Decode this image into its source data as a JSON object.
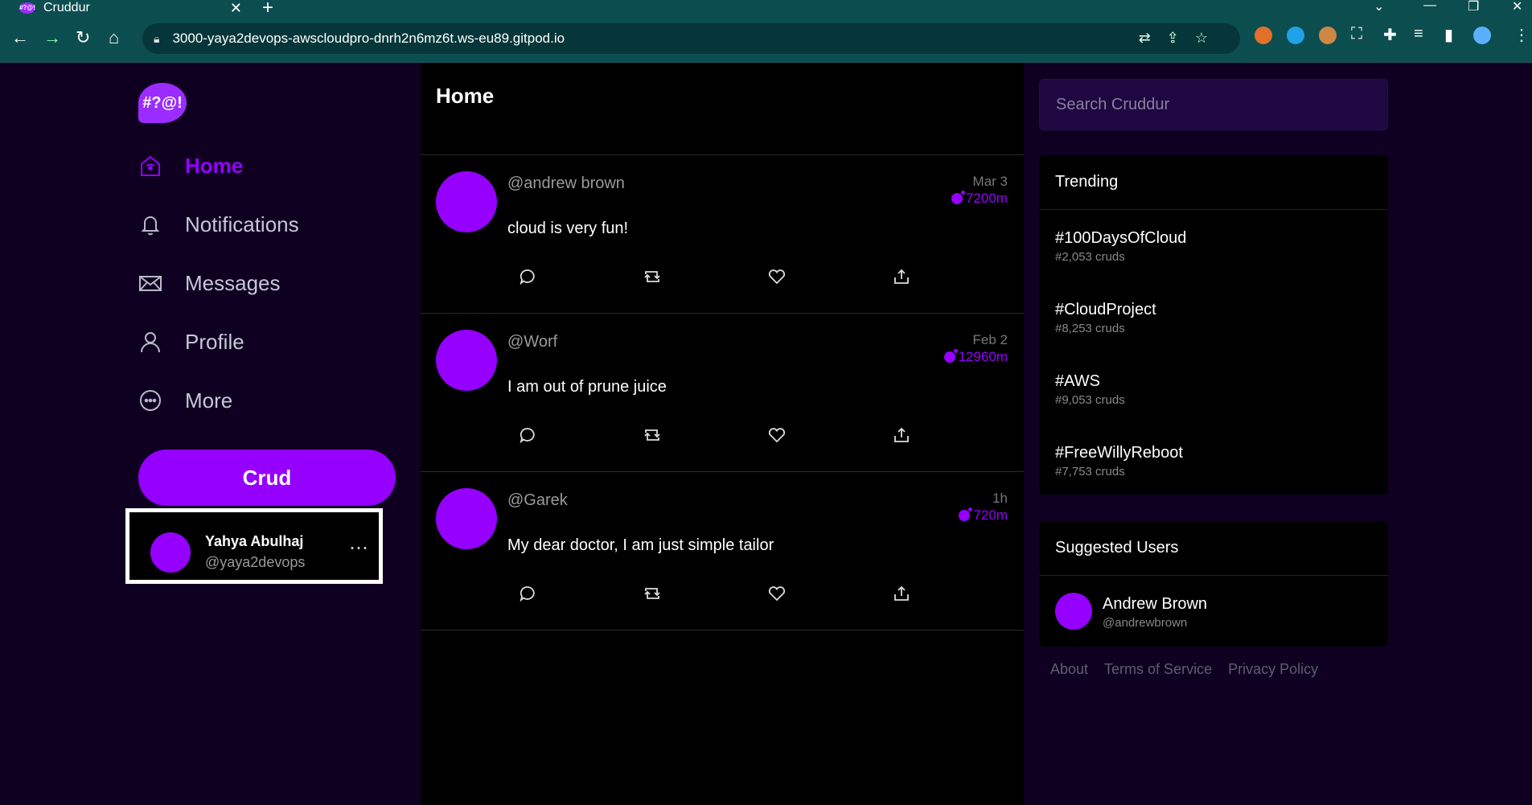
{
  "browser": {
    "tab_title": "Cruddur",
    "tab_favicon_text": "#?@!",
    "url": "3000-yaya2devops-awscloudpro-dnrh2n6mz6t.ws-eu89.gitpod.io"
  },
  "app": {
    "logo_text": "#?@!",
    "nav": [
      {
        "label": "Home",
        "icon": "home-icon",
        "active": true
      },
      {
        "label": "Notifications",
        "icon": "bell-icon"
      },
      {
        "label": "Messages",
        "icon": "envelope-icon"
      },
      {
        "label": "Profile",
        "icon": "person-icon"
      },
      {
        "label": "More",
        "icon": "ellipsis-circle-icon"
      }
    ],
    "crud_button": "Crud",
    "profile": {
      "name": "Yahya Abulhaj",
      "handle": "@yaya2devops",
      "more": "⋯"
    },
    "accent": "#9500ff"
  },
  "feed": {
    "title": "Home",
    "cruds": [
      {
        "handle": "@andrew brown",
        "date": "Mar 3",
        "expires": "7200m",
        "message": "cloud is very fun!"
      },
      {
        "handle": "@Worf",
        "date": "Feb 2",
        "expires": "12960m",
        "message": "I am out of prune juice"
      },
      {
        "handle": "@Garek",
        "date": "1h",
        "expires": "720m",
        "message": "My dear doctor, I am just simple tailor"
      }
    ]
  },
  "sidebar": {
    "search_placeholder": "Search Cruddur",
    "trending_title": "Trending",
    "trending": [
      {
        "tag": "#100DaysOfCloud",
        "count": "#2,053 cruds"
      },
      {
        "tag": "#CloudProject",
        "count": "#8,253 cruds"
      },
      {
        "tag": "#AWS",
        "count": "#9,053 cruds"
      },
      {
        "tag": "#FreeWillyReboot",
        "count": "#7,753 cruds"
      }
    ],
    "suggested_title": "Suggested Users",
    "suggested": [
      {
        "name": "Andrew Brown",
        "handle": "@andrewbrown"
      }
    ],
    "footer": [
      "About",
      "Terms of Service",
      "Privacy Policy"
    ]
  }
}
